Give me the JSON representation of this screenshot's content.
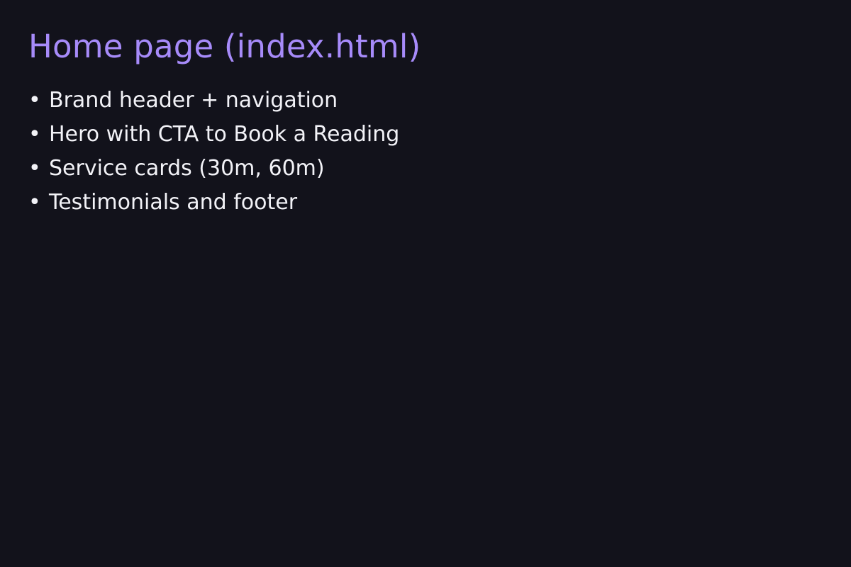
{
  "colors": {
    "background": "#12121b",
    "title": "#a78bfa",
    "text": "#f2f2f7"
  },
  "slide": {
    "title": "Home page (index.html)",
    "bullet_marker": "•",
    "bullets": [
      "Brand header + navigation",
      "Hero with CTA to Book a Reading",
      "Service cards (30m, 60m)",
      "Testimonials and footer"
    ]
  }
}
